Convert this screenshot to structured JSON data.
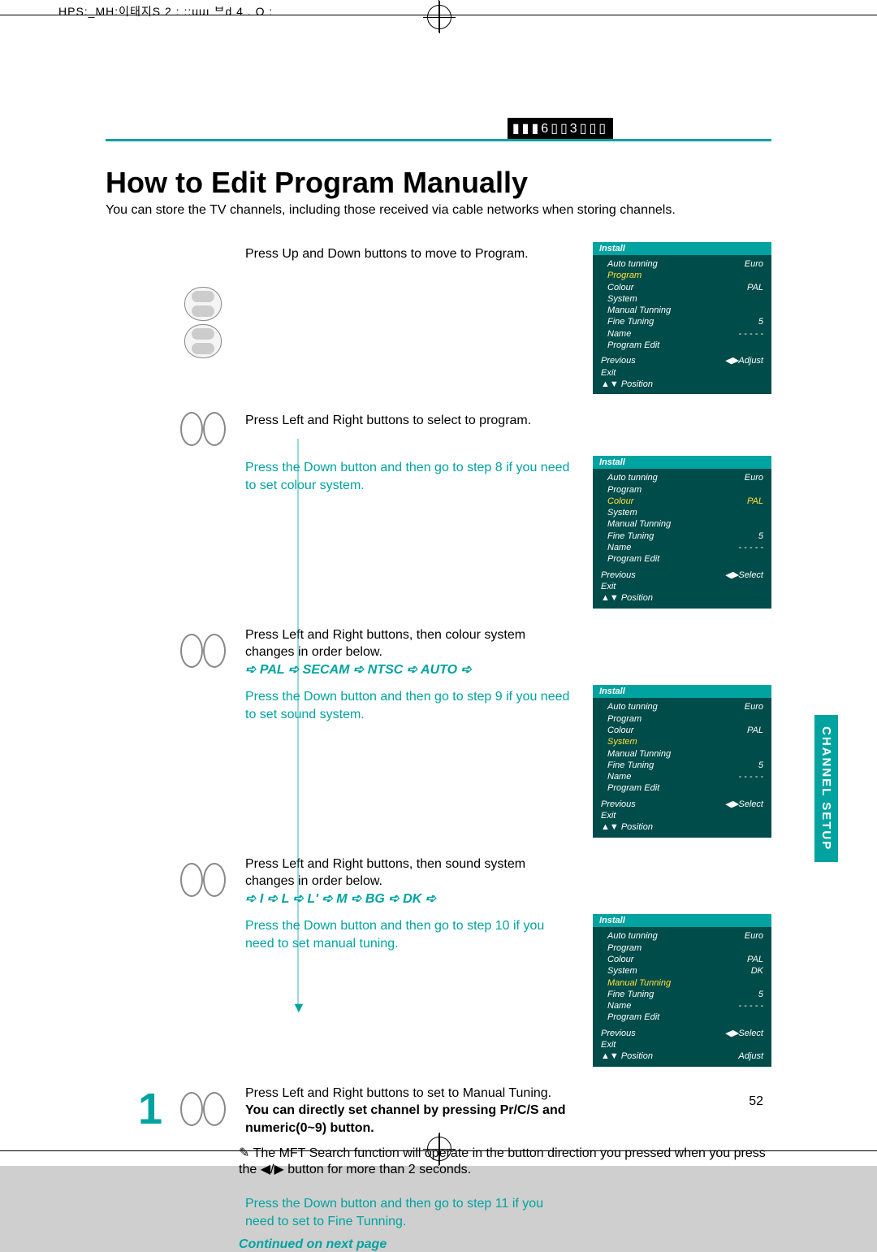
{
  "meta_header": "HPS:_MH:이태지S 2   :    ::uuı  ᄇd 4 . O :",
  "title_block": "▮▮▮6▯▯3▯▯▯",
  "page_title": "How to Edit Program Manually",
  "intro": "You can store the TV channels, including those received via cable networks when storing channels.",
  "side_tab": "CHANNEL SETUP",
  "big_number": "1",
  "steps": {
    "s1": "Press Up and Down buttons to move to Program.",
    "s2": "Press Left and Right buttons to select to program.",
    "s3": "Press the Down button and then go to step 8 if you need to set colour system.",
    "s4a": "Press Left and Right buttons, then colour system changes in order below.",
    "s4b": "➪ PAL ➪ SECAM ➪ NTSC ➪ AUTO ➪",
    "s5": "Press the Down button and then go to step 9 if you need to set sound system.",
    "s6a": "Press Left and Right buttons, then sound system changes in order below.",
    "s6b": "➪ I ➪ L ➪ L' ➪ M ➪ BG ➪ DK ➪",
    "s7": "Press the Down button and then go to step 10 if you need to set manual tuning.",
    "s8a": "Press Left and Right buttons to set to Manual Tuning.",
    "s8b": "You can directly set channel by pressing Pr/C/S and numeric(0~9) button.",
    "note": "✎ The MFT Search function will operate in the button direction you pressed when you press the ◀/▶ button for more than 2 seconds.",
    "s9": "Press the Down button and then go to step 11 if you need to set to Fine Tunning."
  },
  "continued": "Continued on next page",
  "page_number": "52",
  "osd": {
    "title": "Install",
    "rows": [
      {
        "k": "Auto tunning",
        "v": "Euro"
      },
      {
        "k": "Program",
        "v": ""
      },
      {
        "k": "Colour",
        "v": "PAL"
      },
      {
        "k": "System",
        "v": ""
      },
      {
        "k": "Manual Tunning",
        "v": ""
      },
      {
        "k": "Fine Tuning",
        "v": "5"
      },
      {
        "k": "Name",
        "v": "- - - - -"
      },
      {
        "k": "Program Edit",
        "v": ""
      }
    ],
    "foot1": {
      "k": "Previous",
      "v": "◀▶Adjust"
    },
    "foot2": {
      "k": "Exit",
      "v": ""
    },
    "foot3": {
      "k": "▲▼ Position",
      "v": ""
    },
    "foot_select": "◀▶Select",
    "foot_adjust2": "Adjust"
  }
}
